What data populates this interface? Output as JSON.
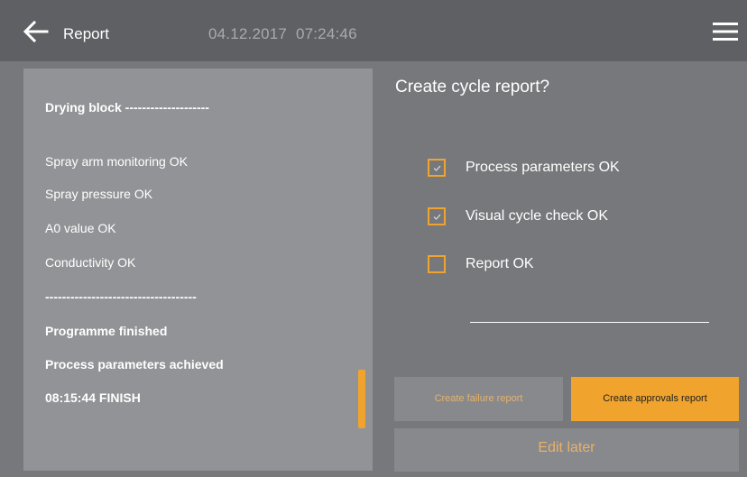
{
  "header": {
    "title": "Report",
    "date": "04.12.2017",
    "time": "07:24:46",
    "back_icon": "arrow-left-icon",
    "menu_icon": "hamburger-menu-icon"
  },
  "log": {
    "lines": [
      {
        "text": "Drying block --------------------",
        "bold": true
      },
      {
        "text": "Spray arm monitoring OK",
        "bold": false
      },
      {
        "text": "Spray pressure OK",
        "bold": false
      },
      {
        "text": "A0 value OK",
        "bold": false
      },
      {
        "text": "Conductivity OK",
        "bold": false
      },
      {
        "text": "------------------------------------",
        "bold": true
      },
      {
        "text": "Programme finished",
        "bold": true
      },
      {
        "text": "Process parameters achieved",
        "bold": true
      },
      {
        "text": "08:15:44 FINISH",
        "bold": true
      }
    ]
  },
  "dialog": {
    "question": "Create cycle report?",
    "checks": [
      {
        "label": "Process parameters OK",
        "checked": true
      },
      {
        "label": "Visual cycle check OK",
        "checked": true
      },
      {
        "label": "Report OK",
        "checked": false
      }
    ]
  },
  "buttons": {
    "failure_label": "Create failure report",
    "approvals_label": "Create approvals report",
    "edit_later_label": "Edit later"
  },
  "colors": {
    "accent": "#f0a42d",
    "header_bg": "#5f6063",
    "background": "#77787b",
    "panel_bg": "#929396"
  }
}
